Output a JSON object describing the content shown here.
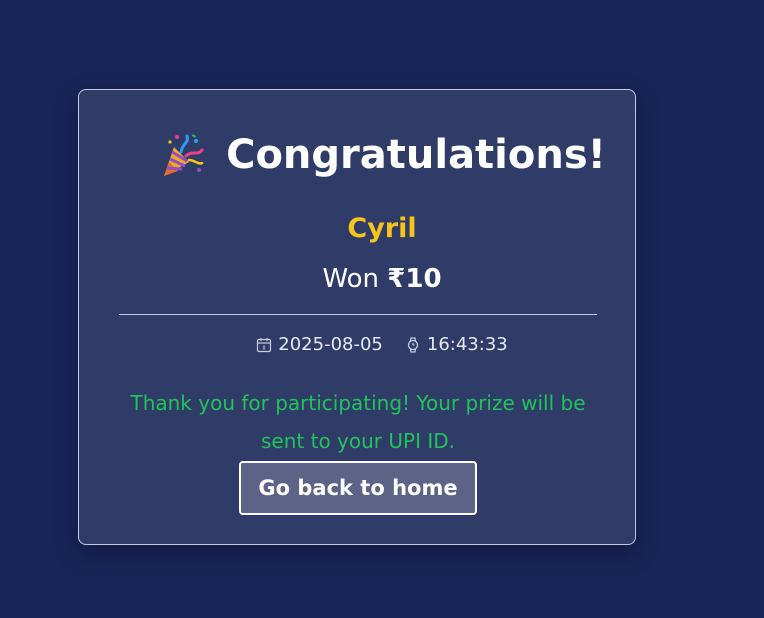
{
  "card": {
    "title": "Congratulations!",
    "title_icon": "party-popper-icon",
    "winner_name": "Cyril",
    "won_prefix": "Won",
    "won_amount": "₹10",
    "date_icon": "calendar-icon",
    "date": "2025-08-05",
    "time_icon": "watch-icon",
    "time": "16:43:33",
    "message": "Thank you for participating! Your prize will be sent to your UPI ID.",
    "button_label": "Go back to home"
  },
  "colors": {
    "background": "#172558",
    "card": "#303c68",
    "name": "#f7c41b",
    "message": "#20c35a",
    "button": "#5c6387"
  }
}
